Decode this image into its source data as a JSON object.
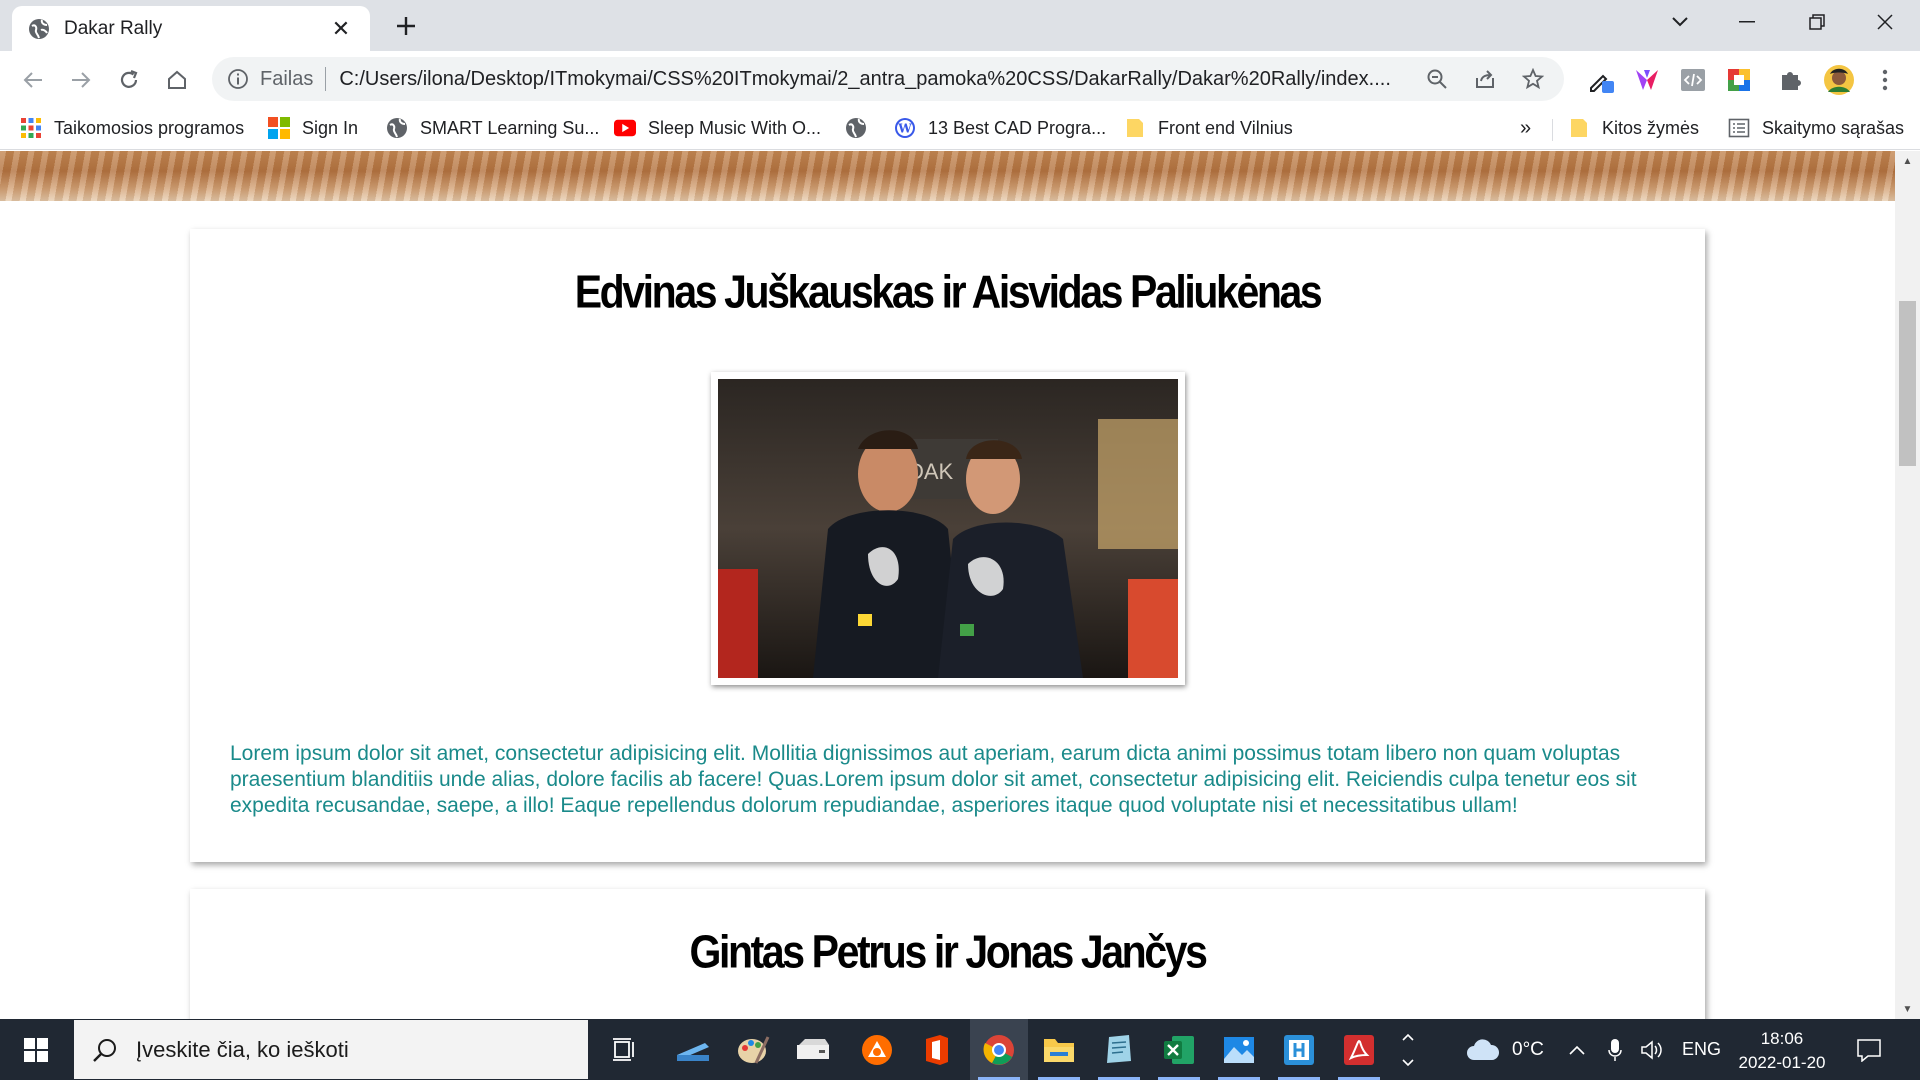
{
  "browser": {
    "tab": {
      "title": "Dakar Rally"
    },
    "address": {
      "scheme_label": "Failas",
      "url": "C:/Users/ilona/Desktop/ITmokymai/CSS%20ITmokymai/2_antra_pamoka%20CSS/DakarRally/Dakar%20Rally/index...."
    },
    "bookmarks": [
      {
        "label": "Taikomosios programos",
        "icon": "apps-grid-icon"
      },
      {
        "label": "Sign In",
        "icon": "microsoft-icon"
      },
      {
        "label": "SMART Learning Su...",
        "icon": "globe-icon"
      },
      {
        "label": "Sleep Music With O...",
        "icon": "youtube-icon"
      },
      {
        "label": "",
        "icon": "globe-icon"
      },
      {
        "label": "13 Best CAD Progra...",
        "icon": "wordpress-icon"
      },
      {
        "label": "Front end Vilnius",
        "icon": "folder-icon"
      }
    ],
    "bookmarks_overflow": "»",
    "other_bookmarks": "Kitos žymės",
    "reading_list": "Skaitymo sąrašas"
  },
  "page": {
    "cards": [
      {
        "title": "Edvinas Juškauskas ir Aisvidas Paliukėnas",
        "text": "Lorem ipsum dolor sit amet, consectetur adipisicing elit. Mollitia dignissimos aut aperiam, earum dicta animi possimus totam libero non quam voluptas praesentium blanditiis unde alias, dolore facilis ab facere! Quas.Lorem ipsum dolor sit amet, consectetur adipisicing elit. Reiciendis culpa tenetur eos sit expedita recusandae, saepe, a illo! Eaque repellendus dolorum repudiandae, asperiores itaque quod voluptate nisi et necessitatibus ullam!"
      },
      {
        "title": "Gintas Petrus ir Jonas Jančys"
      }
    ],
    "photo_sign": "DAK"
  },
  "taskbar": {
    "search_placeholder": "Įveskite čia, ko ieškoti",
    "weather": "0°C",
    "language": "ENG",
    "time": "18:06",
    "date": "2022-01-20"
  },
  "colors": {
    "paragraph": "#1a8a8a",
    "taskbar": "#202833",
    "tabstrip": "#dee1e6"
  }
}
